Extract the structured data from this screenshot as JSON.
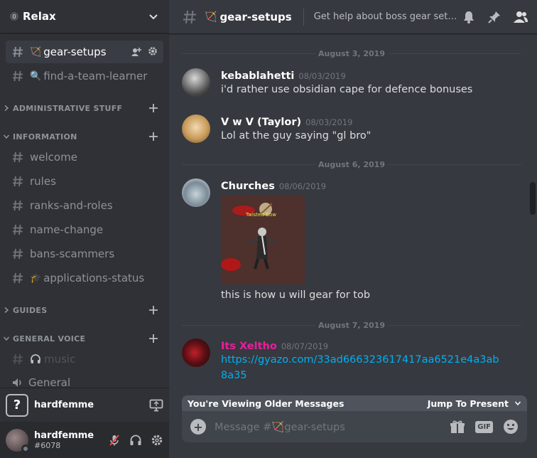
{
  "server": {
    "name": "Relax",
    "badge": "0"
  },
  "sidebar": {
    "active_channel": {
      "emoji": "🏹",
      "name": "gear-setups"
    },
    "channel_find": {
      "emoji": "🔍",
      "name": "find-a-team-learner"
    },
    "categories": {
      "administrative": "ADMINISTRATIVE STUFF",
      "information": "INFORMATION",
      "guides": "GUIDES",
      "general_voice": "GENERAL VOICE"
    },
    "info_channels": [
      {
        "name": "welcome"
      },
      {
        "name": "rules"
      },
      {
        "name": "ranks-and-roles"
      },
      {
        "name": "name-change"
      },
      {
        "name": "bans-scammers"
      },
      {
        "name": "applications-status",
        "emoji": "🎓"
      }
    ],
    "voice_channels": [
      {
        "name": "music",
        "icon": "headphones-icon"
      },
      {
        "name": "General",
        "icon": "speaker-icon"
      }
    ]
  },
  "panel_top": {
    "label": "hardfemme",
    "icon": "question-icon"
  },
  "user": {
    "name": "hardfemme",
    "discriminator": "#6078"
  },
  "header": {
    "channel_emoji": "🏹",
    "channel_name": "gear-setups",
    "topic": "Get help about boss gear setups ..."
  },
  "dates": [
    "August 3, 2019",
    "August 6, 2019",
    "August 7, 2019"
  ],
  "messages": [
    {
      "author": "kebablahetti",
      "timestamp": "08/03/2019",
      "text": "i'd rather use obsidian cape for defence bonuses",
      "author_color": "#ffffff"
    },
    {
      "author": "V w V (Taylor)",
      "timestamp": "08/03/2019",
      "text": "Lol at the guy saying \"gl bro\"",
      "author_color": "#ffffff"
    },
    {
      "author": "Churches",
      "timestamp": "08/06/2019",
      "text": "this is how u will gear for tob",
      "author_color": "#ffffff",
      "attachment_label": "Twisted Bow"
    },
    {
      "author": "Its Xeltho",
      "timestamp": "08/07/2019",
      "link": "https://gyazo.com/33ad666323617417aa6521e4a3ab8a35",
      "author_color": "#e91e9a"
    }
  ],
  "older_bar": {
    "label": "You're Viewing Older Messages",
    "jump_label": "Jump To Present"
  },
  "composer": {
    "placeholder_prefix": "Message #",
    "channel_emoji": "🏹",
    "channel_name": "gear-setups",
    "gif_label": "GIF"
  }
}
